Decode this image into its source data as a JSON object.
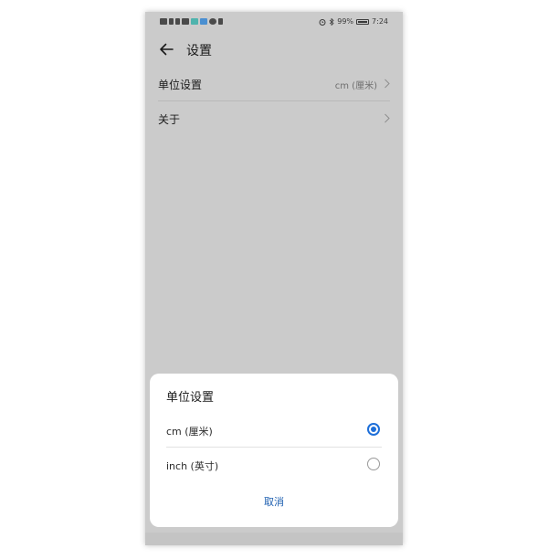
{
  "status_bar": {
    "battery": "99%",
    "time": "7:24"
  },
  "header": {
    "title": "设置"
  },
  "settings": {
    "items": [
      {
        "label": "单位设置",
        "value": "cm (厘米)"
      },
      {
        "label": "关于",
        "value": ""
      }
    ]
  },
  "dialog": {
    "title": "单位设置",
    "options": [
      {
        "label": "cm (厘米)",
        "selected": true
      },
      {
        "label": "inch (英寸)",
        "selected": false
      }
    ],
    "cancel_label": "取消"
  },
  "colors": {
    "accent": "#1e6fd9",
    "cancel_text": "#1e5fb0",
    "dim_background": "#cbcbcb"
  },
  "icons": [
    "back-arrow-icon",
    "chevron-right-icon",
    "alarm-icon",
    "bluetooth-icon",
    "battery-icon"
  ]
}
